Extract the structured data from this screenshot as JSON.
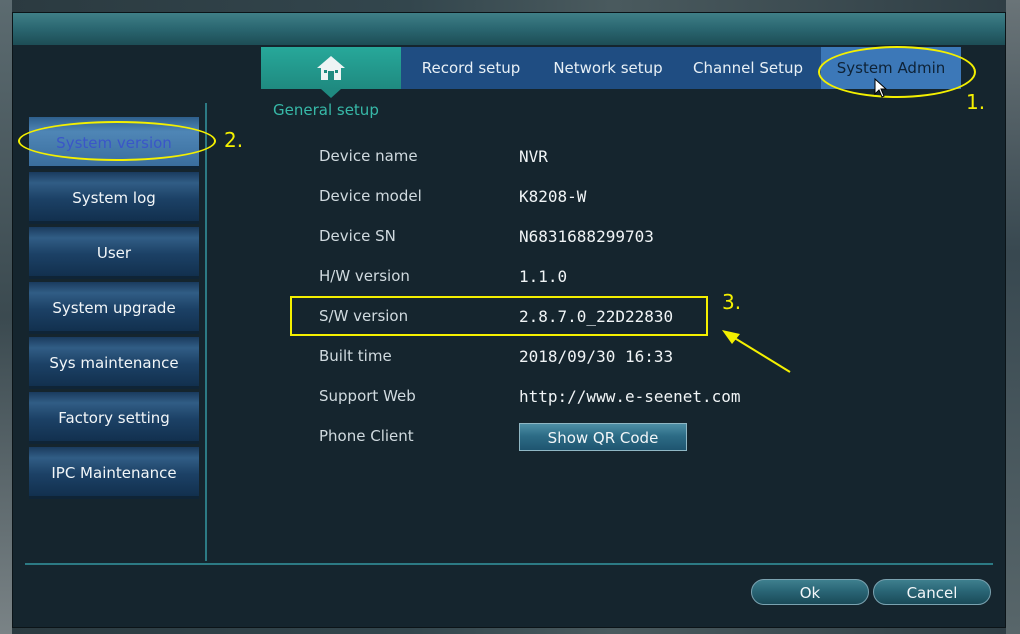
{
  "tabs": [
    {
      "label": "General setup"
    },
    {
      "label": "Record setup"
    },
    {
      "label": "Network setup"
    },
    {
      "label": "Channel Setup"
    },
    {
      "label": "System Admin"
    }
  ],
  "sidebar": {
    "items": [
      {
        "label": "System version"
      },
      {
        "label": "System log"
      },
      {
        "label": "User"
      },
      {
        "label": "System upgrade"
      },
      {
        "label": "Sys maintenance"
      },
      {
        "label": "Factory setting"
      },
      {
        "label": "IPC Maintenance"
      }
    ]
  },
  "info": {
    "rows": [
      {
        "label": "Device name",
        "value": "NVR"
      },
      {
        "label": "Device model",
        "value": "K8208-W"
      },
      {
        "label": "Device SN",
        "value": "N6831688299703"
      },
      {
        "label": "H/W version",
        "value": "1.1.0"
      },
      {
        "label": "S/W version",
        "value": "2.8.7.0_22D22830"
      },
      {
        "label": "Built time",
        "value": "2018/09/30 16:33"
      },
      {
        "label": "Support Web",
        "value": "http://www.e-seenet.com"
      },
      {
        "label": "Phone Client",
        "value": ""
      }
    ],
    "qr_button": "Show QR Code"
  },
  "footer": {
    "ok_label": "Ok",
    "cancel_label": "Cancel"
  },
  "annotations": {
    "step1": "1.",
    "step2": "2.",
    "step3": "3.",
    "color": "#f4f000"
  },
  "colors": {
    "tab_general": "#1f8a80",
    "tab_bar": "#1f4d82",
    "tab_active": "#3c78b8",
    "divider": "#2c7a84"
  },
  "icons": {
    "general_setup": "home-icon"
  }
}
